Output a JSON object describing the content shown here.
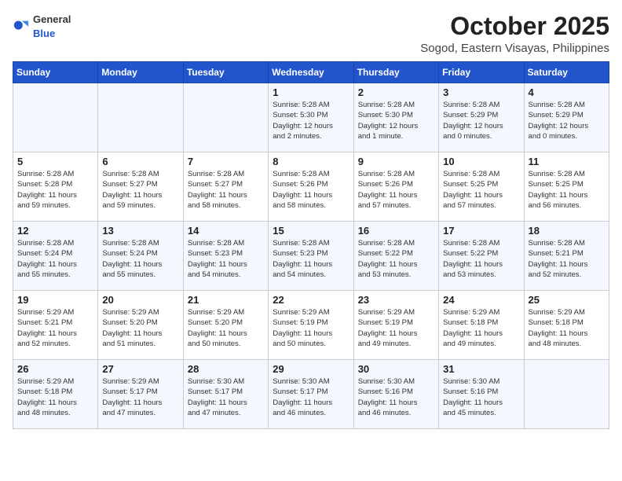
{
  "header": {
    "logo_general": "General",
    "logo_blue": "Blue",
    "month": "October 2025",
    "location": "Sogod, Eastern Visayas, Philippines"
  },
  "weekdays": [
    "Sunday",
    "Monday",
    "Tuesday",
    "Wednesday",
    "Thursday",
    "Friday",
    "Saturday"
  ],
  "weeks": [
    [
      {
        "day": "",
        "info": ""
      },
      {
        "day": "",
        "info": ""
      },
      {
        "day": "",
        "info": ""
      },
      {
        "day": "1",
        "info": "Sunrise: 5:28 AM\nSunset: 5:30 PM\nDaylight: 12 hours\nand 2 minutes."
      },
      {
        "day": "2",
        "info": "Sunrise: 5:28 AM\nSunset: 5:30 PM\nDaylight: 12 hours\nand 1 minute."
      },
      {
        "day": "3",
        "info": "Sunrise: 5:28 AM\nSunset: 5:29 PM\nDaylight: 12 hours\nand 0 minutes."
      },
      {
        "day": "4",
        "info": "Sunrise: 5:28 AM\nSunset: 5:29 PM\nDaylight: 12 hours\nand 0 minutes."
      }
    ],
    [
      {
        "day": "5",
        "info": "Sunrise: 5:28 AM\nSunset: 5:28 PM\nDaylight: 11 hours\nand 59 minutes."
      },
      {
        "day": "6",
        "info": "Sunrise: 5:28 AM\nSunset: 5:27 PM\nDaylight: 11 hours\nand 59 minutes."
      },
      {
        "day": "7",
        "info": "Sunrise: 5:28 AM\nSunset: 5:27 PM\nDaylight: 11 hours\nand 58 minutes."
      },
      {
        "day": "8",
        "info": "Sunrise: 5:28 AM\nSunset: 5:26 PM\nDaylight: 11 hours\nand 58 minutes."
      },
      {
        "day": "9",
        "info": "Sunrise: 5:28 AM\nSunset: 5:26 PM\nDaylight: 11 hours\nand 57 minutes."
      },
      {
        "day": "10",
        "info": "Sunrise: 5:28 AM\nSunset: 5:25 PM\nDaylight: 11 hours\nand 57 minutes."
      },
      {
        "day": "11",
        "info": "Sunrise: 5:28 AM\nSunset: 5:25 PM\nDaylight: 11 hours\nand 56 minutes."
      }
    ],
    [
      {
        "day": "12",
        "info": "Sunrise: 5:28 AM\nSunset: 5:24 PM\nDaylight: 11 hours\nand 55 minutes."
      },
      {
        "day": "13",
        "info": "Sunrise: 5:28 AM\nSunset: 5:24 PM\nDaylight: 11 hours\nand 55 minutes."
      },
      {
        "day": "14",
        "info": "Sunrise: 5:28 AM\nSunset: 5:23 PM\nDaylight: 11 hours\nand 54 minutes."
      },
      {
        "day": "15",
        "info": "Sunrise: 5:28 AM\nSunset: 5:23 PM\nDaylight: 11 hours\nand 54 minutes."
      },
      {
        "day": "16",
        "info": "Sunrise: 5:28 AM\nSunset: 5:22 PM\nDaylight: 11 hours\nand 53 minutes."
      },
      {
        "day": "17",
        "info": "Sunrise: 5:28 AM\nSunset: 5:22 PM\nDaylight: 11 hours\nand 53 minutes."
      },
      {
        "day": "18",
        "info": "Sunrise: 5:28 AM\nSunset: 5:21 PM\nDaylight: 11 hours\nand 52 minutes."
      }
    ],
    [
      {
        "day": "19",
        "info": "Sunrise: 5:29 AM\nSunset: 5:21 PM\nDaylight: 11 hours\nand 52 minutes."
      },
      {
        "day": "20",
        "info": "Sunrise: 5:29 AM\nSunset: 5:20 PM\nDaylight: 11 hours\nand 51 minutes."
      },
      {
        "day": "21",
        "info": "Sunrise: 5:29 AM\nSunset: 5:20 PM\nDaylight: 11 hours\nand 50 minutes."
      },
      {
        "day": "22",
        "info": "Sunrise: 5:29 AM\nSunset: 5:19 PM\nDaylight: 11 hours\nand 50 minutes."
      },
      {
        "day": "23",
        "info": "Sunrise: 5:29 AM\nSunset: 5:19 PM\nDaylight: 11 hours\nand 49 minutes."
      },
      {
        "day": "24",
        "info": "Sunrise: 5:29 AM\nSunset: 5:18 PM\nDaylight: 11 hours\nand 49 minutes."
      },
      {
        "day": "25",
        "info": "Sunrise: 5:29 AM\nSunset: 5:18 PM\nDaylight: 11 hours\nand 48 minutes."
      }
    ],
    [
      {
        "day": "26",
        "info": "Sunrise: 5:29 AM\nSunset: 5:18 PM\nDaylight: 11 hours\nand 48 minutes."
      },
      {
        "day": "27",
        "info": "Sunrise: 5:29 AM\nSunset: 5:17 PM\nDaylight: 11 hours\nand 47 minutes."
      },
      {
        "day": "28",
        "info": "Sunrise: 5:30 AM\nSunset: 5:17 PM\nDaylight: 11 hours\nand 47 minutes."
      },
      {
        "day": "29",
        "info": "Sunrise: 5:30 AM\nSunset: 5:17 PM\nDaylight: 11 hours\nand 46 minutes."
      },
      {
        "day": "30",
        "info": "Sunrise: 5:30 AM\nSunset: 5:16 PM\nDaylight: 11 hours\nand 46 minutes."
      },
      {
        "day": "31",
        "info": "Sunrise: 5:30 AM\nSunset: 5:16 PM\nDaylight: 11 hours\nand 45 minutes."
      },
      {
        "day": "",
        "info": ""
      }
    ]
  ]
}
